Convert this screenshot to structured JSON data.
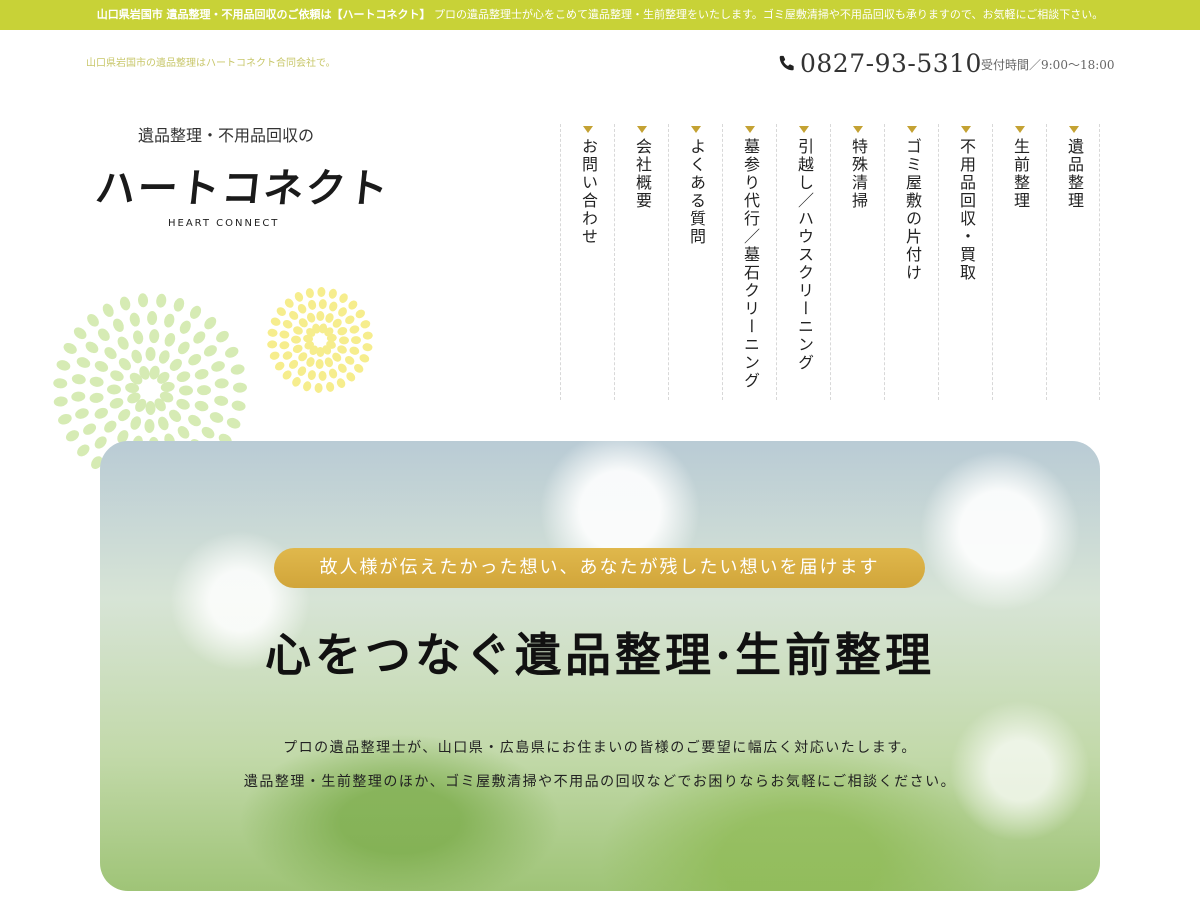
{
  "topbar": {
    "lead": "山口県岩国市 遺品整理・不用品回収のご依頼は【ハートコネクト】",
    "text": "プロの遺品整理士が心をこめて遺品整理・生前整理をいたします。ゴミ屋敷清掃や不用品回収も承りますので、お気軽にご相談下さい。"
  },
  "header": {
    "subtitle": "山口県岩国市の遺品整理はハートコネクト合同会社で。",
    "phone": "0827-93-5310",
    "hours": "受付時間／9:00〜18:00"
  },
  "logo": {
    "tagline": "遺品整理・不用品回収の",
    "name": "ハートコネクト",
    "english": "HEART CONNECT"
  },
  "nav": {
    "items": [
      {
        "label": "お問い合わせ"
      },
      {
        "label": "会社概要"
      },
      {
        "label": "よくある質問"
      },
      {
        "label": "墓参り代行／墓石クリーニング"
      },
      {
        "label": "引越し／ハウスクリーニング"
      },
      {
        "label": "特殊清掃"
      },
      {
        "label": "ゴミ屋敷の片付け"
      },
      {
        "label": "不用品回収・買取"
      },
      {
        "label": "生前整理"
      },
      {
        "label": "遺品整理"
      }
    ]
  },
  "hero": {
    "pill": "故人様が伝えたかった想い、あなたが残したい想いを届けます",
    "title": "心をつなぐ遺品整理·生前整理",
    "line1": "プロの遺品整理士が、山口県・広島県にお住まいの皆様のご要望に幅広く対応いたします。",
    "line2": "遺品整理・生前整理のほか、ゴミ屋敷清掃や不用品の回収などでお困りならお気軽にご相談ください。"
  },
  "colors": {
    "topbar": "#c8d237",
    "accent_gold": "#d4a93e",
    "nav_arrow": "#c4a233"
  },
  "icons": {
    "phone": "phone-icon",
    "nav_arrow": "triangle-down-icon"
  }
}
